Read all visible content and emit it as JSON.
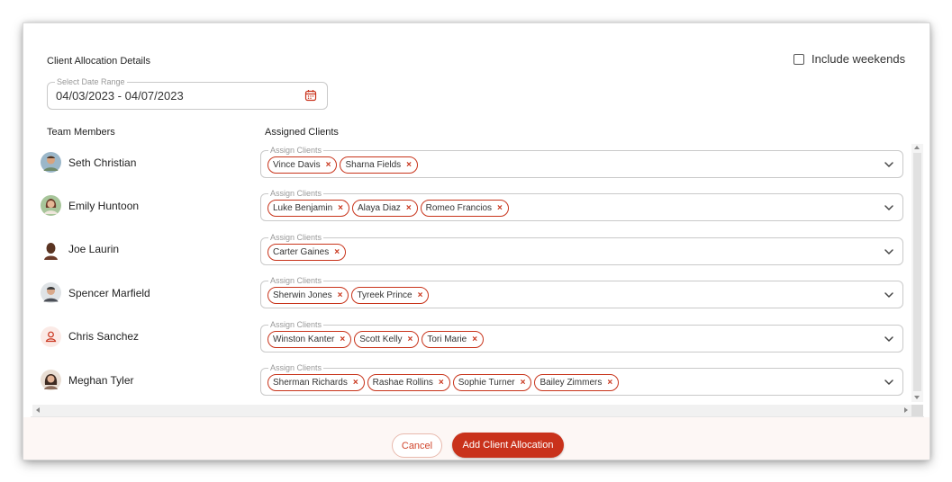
{
  "dialog": {
    "section_title": "Client Allocation Details",
    "include_weekends_label": "Include weekends",
    "include_weekends_checked": false,
    "date_range": {
      "label": "Select Date Range",
      "value": "04/03/2023 - 04/07/2023"
    },
    "columns": {
      "team_members": "Team Members",
      "assigned_clients": "Assigned Clients"
    },
    "field_label": "Assign Clients",
    "remove_glyph": "×",
    "rows": [
      {
        "name": "Seth Christian",
        "avatar": "photo",
        "clients": [
          "Vince Davis",
          "Sharna Fields"
        ]
      },
      {
        "name": "Emily Huntoon",
        "avatar": "photo",
        "clients": [
          "Luke Benjamin",
          "Alaya Diaz",
          "Romeo Francios"
        ]
      },
      {
        "name": "Joe Laurin",
        "avatar": "photo",
        "clients": [
          "Carter Gaines"
        ]
      },
      {
        "name": "Spencer Marfield",
        "avatar": "photo",
        "clients": [
          "Sherwin Jones",
          "Tyreek Prince"
        ]
      },
      {
        "name": "Chris Sanchez",
        "avatar": "person-placeholder-icon",
        "clients": [
          "Winston Kanter",
          "Scott Kelly",
          "Tori Marie"
        ]
      },
      {
        "name": "Meghan Tyler",
        "avatar": "photo",
        "clients": [
          "Sherman Richards",
          "Rashae Rollins",
          "Sophie Turner",
          "Bailey Zimmers"
        ]
      }
    ],
    "buttons": {
      "cancel": "Cancel",
      "add": "Add Client Allocation"
    },
    "colors": {
      "accent": "#c9321b",
      "chip_border": "#c8341b",
      "footer_bg": "#fdf7f5"
    }
  }
}
